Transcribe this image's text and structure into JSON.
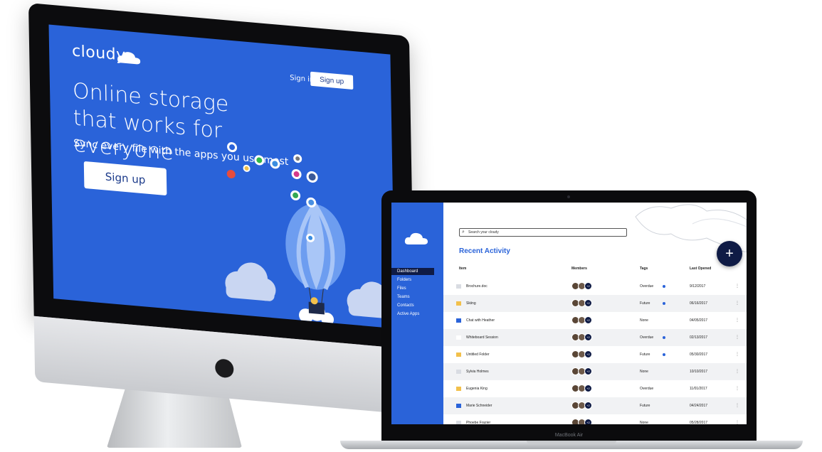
{
  "landing": {
    "brand": "cloudy",
    "hero_title": "Online storage that works for everyone",
    "hero_subtitle": "Sync every file with the apps you use most",
    "hero_button": "Sign up",
    "nav_signin": "Sign in",
    "nav_signup": "Sign up",
    "colors": {
      "primary": "#2a63d9",
      "dark": "#0f1b45"
    }
  },
  "device_label": "MacBook Air",
  "app": {
    "sidebar": {
      "items": [
        {
          "label": "Dashboard",
          "active": true
        },
        {
          "label": "Folders",
          "active": false
        },
        {
          "label": "Files",
          "active": false
        },
        {
          "label": "Teams",
          "active": false
        },
        {
          "label": "Contacts",
          "active": false
        },
        {
          "label": "Active Apps",
          "active": false
        }
      ]
    },
    "search": {
      "placeholder": "Search your cloudy"
    },
    "title": "Recent Activity",
    "fab_label": "+",
    "columns": {
      "item": "Item",
      "members": "Members",
      "tags": "Tags",
      "last_opened": "Last Opened"
    },
    "rows": [
      {
        "item": "Brochure.doc",
        "icon": "doc-icon",
        "extra": "+2",
        "tag": "Overdue",
        "dot": true,
        "date": "9/12/2017"
      },
      {
        "item": "Skiing",
        "icon": "folder-icon",
        "extra": "+2",
        "tag": "Future",
        "dot": true,
        "date": "06/16/2017"
      },
      {
        "item": "Chat with Heather",
        "icon": "chat-icon",
        "extra": "+2",
        "tag": "None",
        "dot": false,
        "date": "04/05/2017"
      },
      {
        "item": "Whiteboard Session",
        "icon": "whiteboard-icon",
        "extra": "+2",
        "tag": "Overdue",
        "dot": true,
        "date": "02/13/2017"
      },
      {
        "item": "Untitled Folder",
        "icon": "folder-icon",
        "extra": "+2",
        "tag": "Future",
        "dot": true,
        "date": "05/30/2017"
      },
      {
        "item": "Sylvia Holmes",
        "icon": "doc-icon",
        "extra": "+2",
        "tag": "None",
        "dot": false,
        "date": "10/10/2017"
      },
      {
        "item": "Eugenia King",
        "icon": "folder-icon",
        "extra": "+2",
        "tag": "Overdue",
        "dot": false,
        "date": "11/01/2017"
      },
      {
        "item": "Marie Schneider",
        "icon": "chat-icon",
        "extra": "+2",
        "tag": "Future",
        "dot": false,
        "date": "04/24/2017"
      },
      {
        "item": "Phoebe Frazier",
        "icon": "doc-icon",
        "extra": "+2",
        "tag": "None",
        "dot": false,
        "date": "05/28/2017"
      }
    ]
  }
}
